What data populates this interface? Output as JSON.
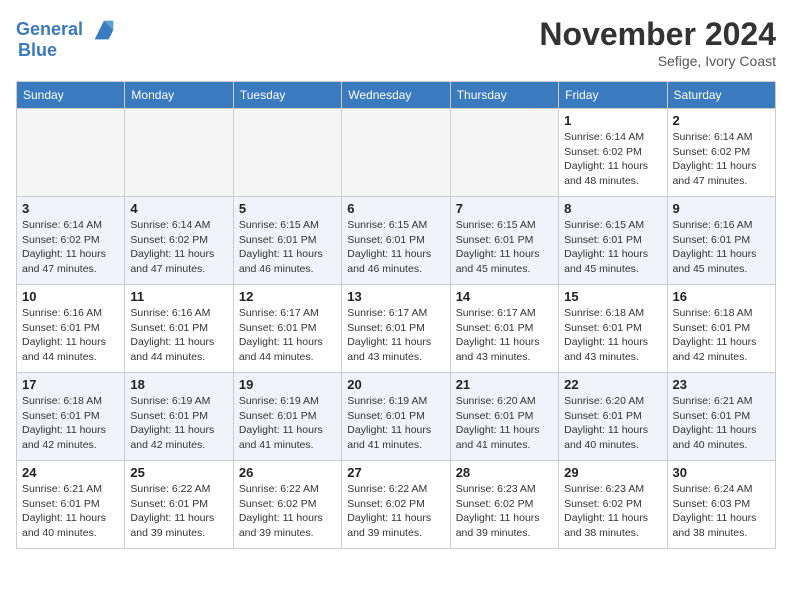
{
  "header": {
    "logo_line1": "General",
    "logo_line2": "Blue",
    "month": "November 2024",
    "location": "Sefige, Ivory Coast"
  },
  "weekdays": [
    "Sunday",
    "Monday",
    "Tuesday",
    "Wednesday",
    "Thursday",
    "Friday",
    "Saturday"
  ],
  "weeks": [
    [
      {
        "day": "",
        "empty": true
      },
      {
        "day": "",
        "empty": true
      },
      {
        "day": "",
        "empty": true
      },
      {
        "day": "",
        "empty": true
      },
      {
        "day": "",
        "empty": true
      },
      {
        "day": "1",
        "sunrise": "Sunrise: 6:14 AM",
        "sunset": "Sunset: 6:02 PM",
        "daylight": "Daylight: 11 hours and 48 minutes."
      },
      {
        "day": "2",
        "sunrise": "Sunrise: 6:14 AM",
        "sunset": "Sunset: 6:02 PM",
        "daylight": "Daylight: 11 hours and 47 minutes."
      }
    ],
    [
      {
        "day": "3",
        "sunrise": "Sunrise: 6:14 AM",
        "sunset": "Sunset: 6:02 PM",
        "daylight": "Daylight: 11 hours and 47 minutes."
      },
      {
        "day": "4",
        "sunrise": "Sunrise: 6:14 AM",
        "sunset": "Sunset: 6:02 PM",
        "daylight": "Daylight: 11 hours and 47 minutes."
      },
      {
        "day": "5",
        "sunrise": "Sunrise: 6:15 AM",
        "sunset": "Sunset: 6:01 PM",
        "daylight": "Daylight: 11 hours and 46 minutes."
      },
      {
        "day": "6",
        "sunrise": "Sunrise: 6:15 AM",
        "sunset": "Sunset: 6:01 PM",
        "daylight": "Daylight: 11 hours and 46 minutes."
      },
      {
        "day": "7",
        "sunrise": "Sunrise: 6:15 AM",
        "sunset": "Sunset: 6:01 PM",
        "daylight": "Daylight: 11 hours and 45 minutes."
      },
      {
        "day": "8",
        "sunrise": "Sunrise: 6:15 AM",
        "sunset": "Sunset: 6:01 PM",
        "daylight": "Daylight: 11 hours and 45 minutes."
      },
      {
        "day": "9",
        "sunrise": "Sunrise: 6:16 AM",
        "sunset": "Sunset: 6:01 PM",
        "daylight": "Daylight: 11 hours and 45 minutes."
      }
    ],
    [
      {
        "day": "10",
        "sunrise": "Sunrise: 6:16 AM",
        "sunset": "Sunset: 6:01 PM",
        "daylight": "Daylight: 11 hours and 44 minutes."
      },
      {
        "day": "11",
        "sunrise": "Sunrise: 6:16 AM",
        "sunset": "Sunset: 6:01 PM",
        "daylight": "Daylight: 11 hours and 44 minutes."
      },
      {
        "day": "12",
        "sunrise": "Sunrise: 6:17 AM",
        "sunset": "Sunset: 6:01 PM",
        "daylight": "Daylight: 11 hours and 44 minutes."
      },
      {
        "day": "13",
        "sunrise": "Sunrise: 6:17 AM",
        "sunset": "Sunset: 6:01 PM",
        "daylight": "Daylight: 11 hours and 43 minutes."
      },
      {
        "day": "14",
        "sunrise": "Sunrise: 6:17 AM",
        "sunset": "Sunset: 6:01 PM",
        "daylight": "Daylight: 11 hours and 43 minutes."
      },
      {
        "day": "15",
        "sunrise": "Sunrise: 6:18 AM",
        "sunset": "Sunset: 6:01 PM",
        "daylight": "Daylight: 11 hours and 43 minutes."
      },
      {
        "day": "16",
        "sunrise": "Sunrise: 6:18 AM",
        "sunset": "Sunset: 6:01 PM",
        "daylight": "Daylight: 11 hours and 42 minutes."
      }
    ],
    [
      {
        "day": "17",
        "sunrise": "Sunrise: 6:18 AM",
        "sunset": "Sunset: 6:01 PM",
        "daylight": "Daylight: 11 hours and 42 minutes."
      },
      {
        "day": "18",
        "sunrise": "Sunrise: 6:19 AM",
        "sunset": "Sunset: 6:01 PM",
        "daylight": "Daylight: 11 hours and 42 minutes."
      },
      {
        "day": "19",
        "sunrise": "Sunrise: 6:19 AM",
        "sunset": "Sunset: 6:01 PM",
        "daylight": "Daylight: 11 hours and 41 minutes."
      },
      {
        "day": "20",
        "sunrise": "Sunrise: 6:19 AM",
        "sunset": "Sunset: 6:01 PM",
        "daylight": "Daylight: 11 hours and 41 minutes."
      },
      {
        "day": "21",
        "sunrise": "Sunrise: 6:20 AM",
        "sunset": "Sunset: 6:01 PM",
        "daylight": "Daylight: 11 hours and 41 minutes."
      },
      {
        "day": "22",
        "sunrise": "Sunrise: 6:20 AM",
        "sunset": "Sunset: 6:01 PM",
        "daylight": "Daylight: 11 hours and 40 minutes."
      },
      {
        "day": "23",
        "sunrise": "Sunrise: 6:21 AM",
        "sunset": "Sunset: 6:01 PM",
        "daylight": "Daylight: 11 hours and 40 minutes."
      }
    ],
    [
      {
        "day": "24",
        "sunrise": "Sunrise: 6:21 AM",
        "sunset": "Sunset: 6:01 PM",
        "daylight": "Daylight: 11 hours and 40 minutes."
      },
      {
        "day": "25",
        "sunrise": "Sunrise: 6:22 AM",
        "sunset": "Sunset: 6:01 PM",
        "daylight": "Daylight: 11 hours and 39 minutes."
      },
      {
        "day": "26",
        "sunrise": "Sunrise: 6:22 AM",
        "sunset": "Sunset: 6:02 PM",
        "daylight": "Daylight: 11 hours and 39 minutes."
      },
      {
        "day": "27",
        "sunrise": "Sunrise: 6:22 AM",
        "sunset": "Sunset: 6:02 PM",
        "daylight": "Daylight: 11 hours and 39 minutes."
      },
      {
        "day": "28",
        "sunrise": "Sunrise: 6:23 AM",
        "sunset": "Sunset: 6:02 PM",
        "daylight": "Daylight: 11 hours and 39 minutes."
      },
      {
        "day": "29",
        "sunrise": "Sunrise: 6:23 AM",
        "sunset": "Sunset: 6:02 PM",
        "daylight": "Daylight: 11 hours and 38 minutes."
      },
      {
        "day": "30",
        "sunrise": "Sunrise: 6:24 AM",
        "sunset": "Sunset: 6:03 PM",
        "daylight": "Daylight: 11 hours and 38 minutes."
      }
    ]
  ]
}
